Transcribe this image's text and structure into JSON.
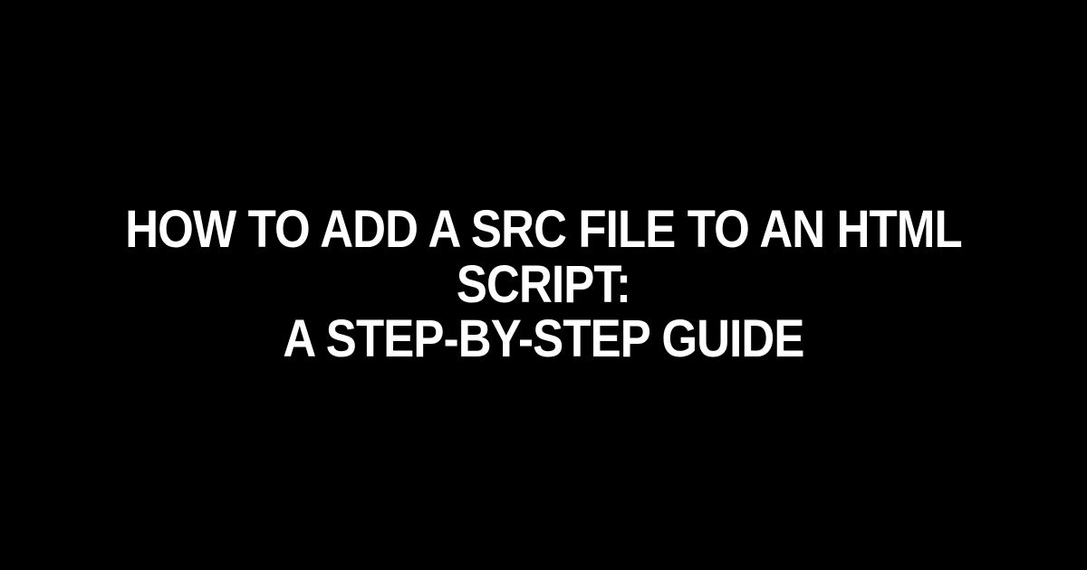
{
  "heading": {
    "line1": "How to Add a SRC File to an HTML Script:",
    "line2": "A Step-by-Step Guide"
  }
}
